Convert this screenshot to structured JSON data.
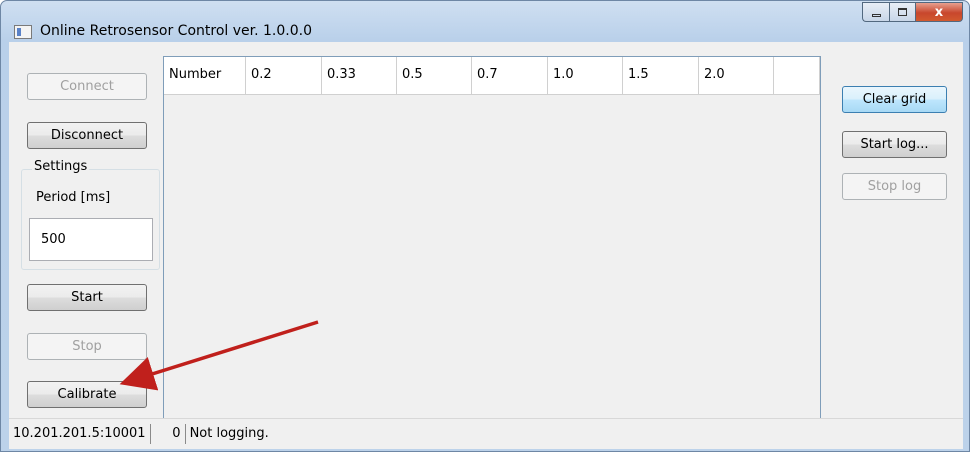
{
  "window": {
    "title": "Online Retrosensor Control ver. 1.0.0.0",
    "close_glyph": "x"
  },
  "left_panel": {
    "connect_label": "Connect",
    "disconnect_label": "Disconnect",
    "settings_title": "Settings",
    "period_label": "Period [ms]",
    "period_value": "500",
    "start_label": "Start",
    "stop_label": "Stop",
    "calibrate_label": "Calibrate"
  },
  "grid": {
    "columns": [
      "Number",
      "0.2",
      "0.33",
      "0.5",
      "0.7",
      "1.0",
      "1.5",
      "2.0",
      ""
    ]
  },
  "right_panel": {
    "clear_grid_label": "Clear grid",
    "start_log_label": "Start log...",
    "stop_log_label": "Stop log"
  },
  "status": {
    "address": "10.201.201.5:10001",
    "count": "0",
    "log_state": "Not logging."
  },
  "colors": {
    "arrow": "#c0201c",
    "focus_border": "#3c7fb1"
  }
}
